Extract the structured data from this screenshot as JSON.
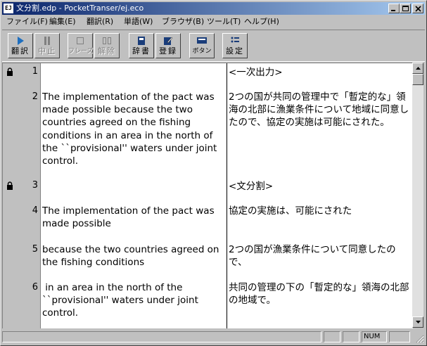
{
  "window": {
    "title": "文分割.edp - PocketTranser/ej.eco",
    "icon": "EJ"
  },
  "menu": [
    {
      "label": "ファイル(F)"
    },
    {
      "label": "編集(E)"
    },
    {
      "label": "翻訳(R)"
    },
    {
      "label": "単語(W)"
    },
    {
      "label": "ブラウザ(B)"
    },
    {
      "label": "ツール(T)"
    },
    {
      "label": "ヘルプ(H)"
    }
  ],
  "toolbar": {
    "translate": "翻訳",
    "stop": "中止",
    "phrase": "フレーズ",
    "release": "解除",
    "dictionary": "辞書",
    "register": "登録",
    "buttons": "ボタン",
    "settings": "設定"
  },
  "rows": [
    {
      "num": "1",
      "source": "",
      "target": "<一次出力>",
      "locked": true
    },
    {
      "num": "2",
      "source": "The implementation of the pact was made possible because the two countries agreed on the fishing conditions in an area in the north of the ``provisional'' waters under joint control.",
      "target": "2つの国が共同の管理中で「暫定的な」領海の北部に漁業条件について地域に同意したので、協定の実施は可能にされた。",
      "locked": false
    },
    {
      "num": "3",
      "source": "",
      "target": "<文分割>",
      "locked": true
    },
    {
      "num": "4",
      "source": "The implementation of the pact was made possible",
      "target": "協定の実施は、可能にされた",
      "locked": false
    },
    {
      "num": "5",
      "source": "because the two countries agreed on the fishing conditions",
      "target": "2つの国が漁業条件について同意したので、",
      "locked": false
    },
    {
      "num": "6",
      "source": " in an area in the north of the ``provisional'' waters under joint control.",
      "target": "共同の管理の下の「暫定的な」領海の北部の地域で。",
      "locked": false
    }
  ],
  "status": {
    "num": "NUM"
  },
  "colors": {
    "titlebar_start": "#0a246a",
    "titlebar_end": "#a6caf0",
    "face": "#c0c0c0",
    "accent_icon": "#1f6fbf"
  }
}
